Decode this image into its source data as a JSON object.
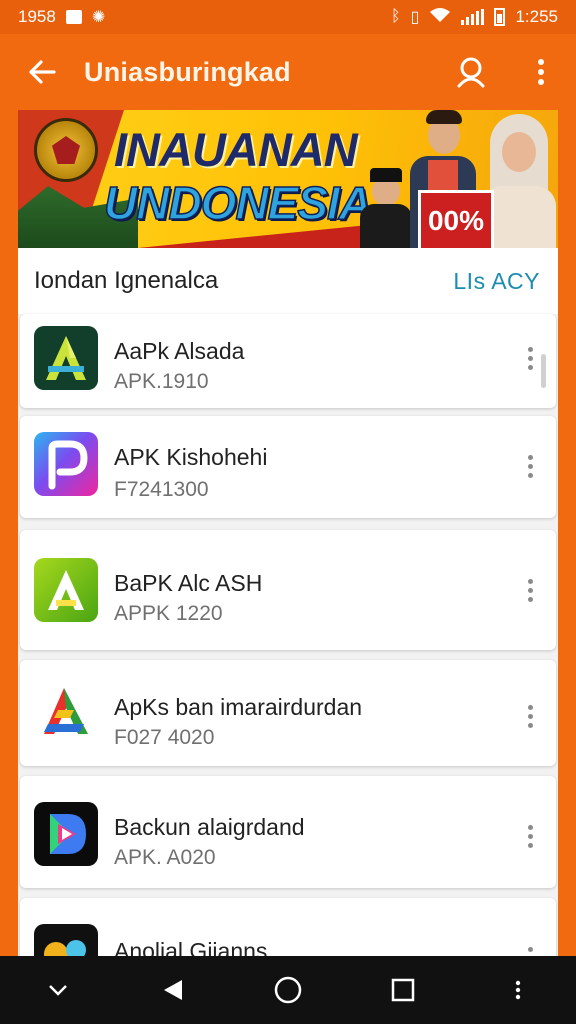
{
  "status_bar": {
    "time_left": "1958",
    "time_right": "1:255"
  },
  "app_bar": {
    "title": "Uniasburingkad",
    "icons": {
      "back": "arrow-left-icon",
      "account": "person-icon",
      "menu": "more-vertical-icon"
    }
  },
  "banner": {
    "line1": "INAUANAN",
    "line2": "UNDONESIA",
    "badge": "00%",
    "colors": {
      "background": "#ffc107",
      "title": "#1f2a6b",
      "subtitle": "#2ea3de",
      "badge": "#cc1f1f"
    }
  },
  "section": {
    "title": "Iondan Ignenalca",
    "link": "LIs ACY"
  },
  "apps": [
    {
      "name": "AaPk Alsada",
      "meta": "APK.1910"
    },
    {
      "name": "APK Kishohehi",
      "meta": "F7241300"
    },
    {
      "name": "BaPK Alc ASH",
      "meta": "APPK 1220"
    },
    {
      "name": "ApKs ban imarairdurdan",
      "meta": "F027 4020"
    },
    {
      "name": "Backun alaigrdand",
      "meta": "APK. A020"
    },
    {
      "name": "Anolial Giianns",
      "meta": ""
    }
  ],
  "theme": {
    "accent": "#f26a0f",
    "link": "#1c8db0",
    "navbar": "#111111"
  }
}
